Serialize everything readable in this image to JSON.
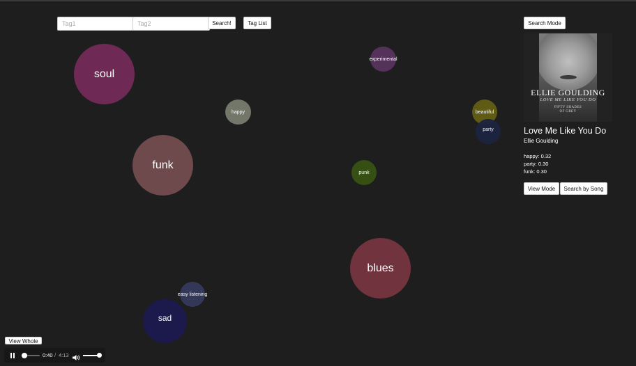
{
  "search": {
    "tag1_placeholder": "Tag1",
    "tag2_placeholder": "Tag2",
    "search_label": "Search!",
    "tag_list_label": "Tag List"
  },
  "bubbles": {
    "soul": "soul",
    "funk": "funk",
    "happy": "happy",
    "experimental": "experimental",
    "punk": "punk",
    "blues": "blues",
    "beautiful": "beautiful",
    "party": "party",
    "easy_listening": "easy listening",
    "sad": "sad"
  },
  "bubble_colors": {
    "soul": "#6e2a55",
    "funk": "#6f4a4c",
    "happy": "#72776a",
    "experimental": "#55325a",
    "punk": "#365014",
    "blues": "#71333e",
    "beautiful": "#5f5a14",
    "party": "#1b2440",
    "easy_listening": "#333858",
    "sad": "#1c1a4c"
  },
  "sidebar": {
    "search_mode_label": "Search Mode",
    "album_art": {
      "artist_text": "ELLIE GOULDING",
      "title_text": "LOVE ME LIKE YOU DO",
      "sub_text_1": "FIFTY SHADES",
      "sub_text_2": "OF GREY"
    },
    "song_title": "Love Me Like You Do",
    "artist": "Ellie Goulding",
    "tag_scores": [
      "happy: 0.32",
      "party: 0.30",
      "funk: 0.30"
    ],
    "view_mode_label": "View Mode",
    "search_by_song_label": "Search by Song"
  },
  "view_whole_label": "View Whole",
  "player": {
    "current_time": "0:40",
    "separator": "/",
    "total_time": "4:13",
    "progress": 0.16,
    "volume": 0.95,
    "play_state_icon": "pause-icon"
  }
}
